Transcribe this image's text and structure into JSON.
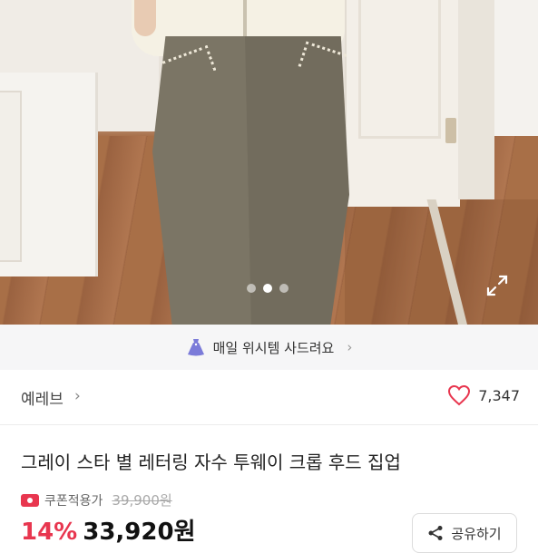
{
  "gallery": {
    "image_alt": "",
    "dots": 3,
    "active_index": 1
  },
  "banner": {
    "text": "매일 위시템 사드려요",
    "chevron": "›",
    "icon": "dress-icon",
    "icon_color": "#7b7bd9"
  },
  "seller": {
    "name": "예레브",
    "chevron": "›",
    "likes": "7,347",
    "heart_color": "#e8364f"
  },
  "product": {
    "title": "그레이 스타 별 레터링 자수 투웨이 크롭 후드 집업",
    "coupon_label": "쿠폰적용가",
    "original_price": "39,900원",
    "discount": "14%",
    "price": "33,920원",
    "accent_color": "#e8364f"
  },
  "actions": {
    "share_label": "공유하기"
  }
}
